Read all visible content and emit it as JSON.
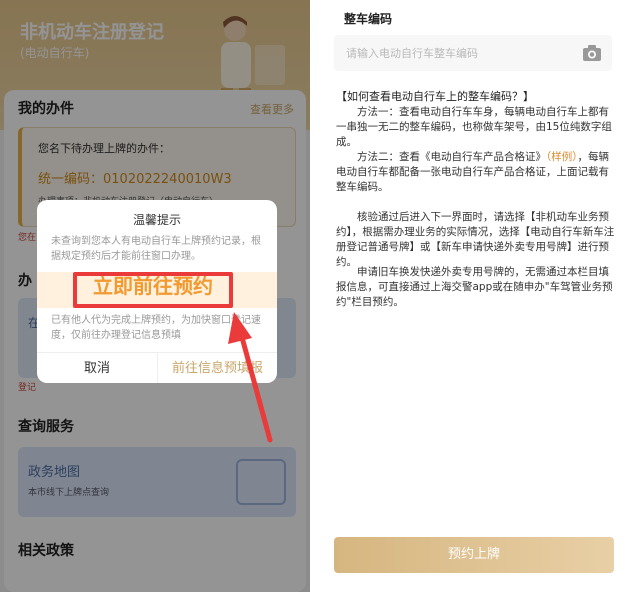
{
  "left": {
    "header_title": "非机动车注册登记",
    "header_subtitle": "(电动自行车)",
    "my_tasks_title": "我的办件",
    "view_more": "查看更多",
    "pending_text": "您名下待办理上牌的办件：",
    "code_line": "统一编码：0102022240010W3",
    "cut_line": "办理事项：非机动车注册登记（电动自行车）",
    "red_note": "您在",
    "handle_title": "办",
    "blue_card_label": "在",
    "bottom_note": "登记",
    "query_title": "查询服务",
    "map_title": "政务地图",
    "map_subtitle": "本市线下上牌点查询",
    "policy_title": "相关政策"
  },
  "dialog": {
    "title": "温馨提示",
    "text1": "未查询到您本人有电动自行车上牌预约记录，根据规定预约后才能前往窗口办理。",
    "highlight": "立即前往预约",
    "text2": "已有他人代为完成上牌预约，为加快窗口登记速度，仅前往办理登记信息预填",
    "cancel": "取消",
    "go_prefill": "前往信息预填报"
  },
  "right": {
    "field_label": "整车编码",
    "input_placeholder": "请输入电动自行车整车编码",
    "help_title": "【如何查看电动自行车上的整车编码？】",
    "method1": "方法一：查看电动自行车车身，每辆电动自行车上都有一串独一无二的整车编码，也称做车架号，由15位纯数字组成。",
    "method2_a": "方法二：查看《电动自行车产品合格证》",
    "method2_link": "（样例）",
    "method2_b": "，每辆电动自行车都配备一张电动自行车产品合格证，上面记载有整车编码。",
    "para3": "核验通过后进入下一界面时，请选择【非机动车业务预约】，根据需办理业务的实际情况，选择【电动自行车新车注册登记普通号牌】或【新车申请快递外卖专用号牌】进行预约。",
    "para4": "申请旧车换发快递外卖专用号牌的，无需通过本栏目填报信息，可直接通过上海交警app或在随申办\"车驾管业务预约\"栏目预约。",
    "submit": "预约上牌"
  },
  "colors": {
    "accent_gold": "#c9a56a",
    "highlight_red": "#ea3a3a",
    "highlight_text": "#f09a30"
  }
}
